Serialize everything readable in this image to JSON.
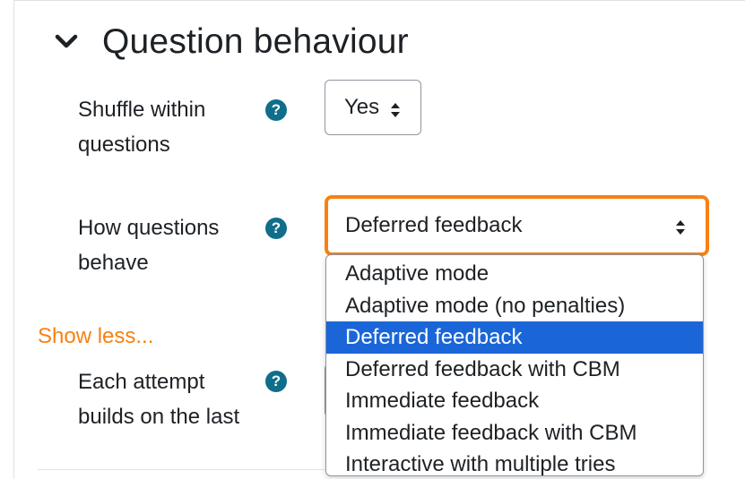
{
  "section": {
    "title": "Question behaviour",
    "toggle_icon": "chevron-down-icon"
  },
  "shuffle": {
    "label_line1": "Shuffle within",
    "label_line2": "questions",
    "help_icon": "help-question-icon",
    "value": "Yes"
  },
  "behaviour": {
    "label_line1": "How questions",
    "label_line2": "behave",
    "help_icon": "help-question-icon",
    "value": "Deferred feedback",
    "options": [
      "Adaptive mode",
      "Adaptive mode (no penalties)",
      "Deferred feedback",
      "Deferred feedback with CBM",
      "Immediate feedback",
      "Immediate feedback with CBM",
      "Interactive with multiple tries"
    ],
    "selected_index": 2
  },
  "show_less": "Show less...",
  "attempt": {
    "label_line1": "Each attempt",
    "label_line2": "builds on the last",
    "help_icon": "help-question-icon"
  },
  "colors": {
    "accent_orange": "#f98012",
    "help_teal": "#0f6e8a",
    "selected_blue": "#1a66d8"
  }
}
